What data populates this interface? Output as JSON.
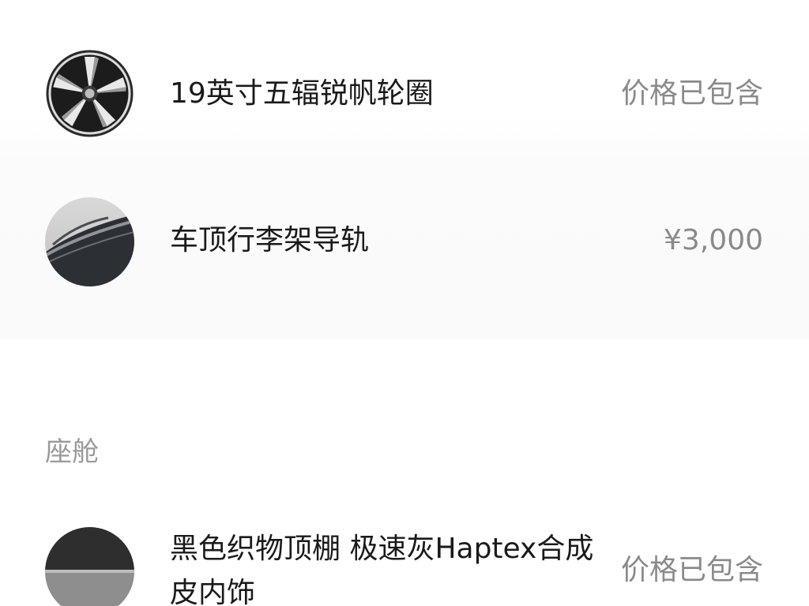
{
  "exterior": {
    "items": [
      {
        "name": "19英寸五辐锐帆轮圈",
        "price": "价格已包含",
        "icon": "wheel-icon"
      },
      {
        "name": "车顶行李架导轨",
        "price": "¥3,000",
        "icon": "roof-rack-icon"
      }
    ]
  },
  "cabin": {
    "title": "座舱",
    "items": [
      {
        "name": "黑色织物顶棚 极速灰Haptex合成皮内饰",
        "price": "价格已包含",
        "icon": "interior-swatch-icon"
      }
    ]
  }
}
